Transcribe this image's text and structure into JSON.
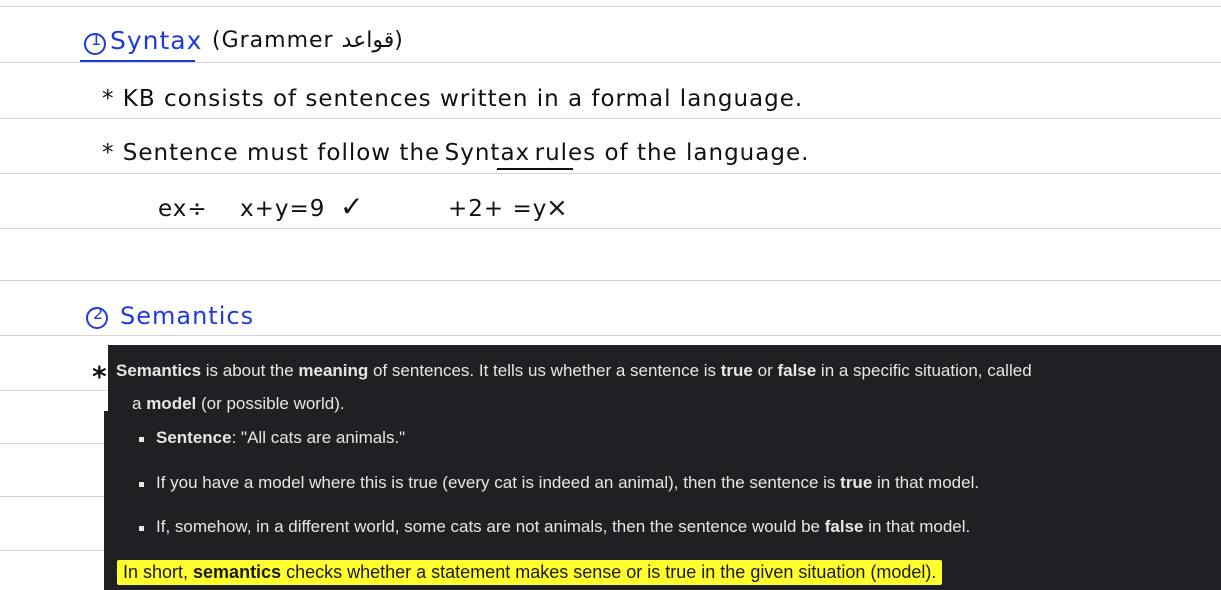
{
  "notes": {
    "section1": {
      "number": "1",
      "title": "Syntax",
      "subtitle": "(Grammer قواعد)",
      "line1": "* KB consists of sentences written in a formal language.",
      "line2_pre": "* Sentence must follow the",
      "line2_syntax": "Syntax",
      "line2_post": "rules of the language.",
      "example_label": "ex÷",
      "example_good": "x+y=9",
      "good_mark": "✓",
      "example_bad": "+2+ =y",
      "bad_mark": "×"
    },
    "section2": {
      "number": "2",
      "title": "Semantics",
      "star": "*"
    }
  },
  "explanation": {
    "intro_term": "Semantics",
    "intro_a": " is about the ",
    "intro_meaning": "meaning",
    "intro_b": " of sentences. It tells us whether a sentence is ",
    "intro_true": "true",
    "intro_c": " or ",
    "intro_false": "false",
    "intro_d": " in a specific situation, called",
    "intro2_a": "a ",
    "intro2_model": "model",
    "intro2_b": " (or possible world).",
    "b1_label": "Sentence",
    "b1_text": ": \"All cats are animals.\"",
    "b2_a": "If you have a model where this is true (every cat is indeed an animal), then the sentence is ",
    "b2_true": "true",
    "b2_b": " in that model.",
    "b3_a": "If, somehow, in a different world, some cats are not animals, then the sentence would be ",
    "b3_false": "false",
    "b3_b": " in that model.",
    "summary_a": "In short, ",
    "summary_term": "semantics",
    "summary_b": " checks whether a statement makes sense or is true in the given situation (model)."
  },
  "colors": {
    "ink_blue": "#1f3bd9",
    "panel_bg": "#1f2023",
    "highlight": "#ffff2e",
    "rule": "#d6d6d6"
  }
}
